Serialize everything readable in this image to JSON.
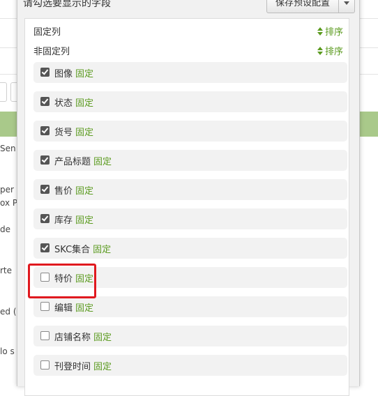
{
  "background": {
    "fragments": [
      "Sen",
      "per",
      "ox P",
      "de",
      "rte",
      "ed (",
      "lo s"
    ]
  },
  "modal": {
    "title": "请勾选要显示的字段",
    "preset_button": "保存预设配置"
  },
  "groups": {
    "fixed": {
      "label": "固定列",
      "sort": "排序"
    },
    "unfixed": {
      "label": "非固定列",
      "sort": "排序"
    }
  },
  "fields": [
    {
      "name": "图像",
      "pin": "固定",
      "checked": true
    },
    {
      "name": "状态",
      "pin": "固定",
      "checked": true
    },
    {
      "name": "货号",
      "pin": "固定",
      "checked": true
    },
    {
      "name": "产品标题",
      "pin": "固定",
      "checked": true
    },
    {
      "name": "售价",
      "pin": "固定",
      "checked": true
    },
    {
      "name": "库存",
      "pin": "固定",
      "checked": true
    },
    {
      "name": "SKC集合",
      "pin": "固定",
      "checked": true
    },
    {
      "name": "特价",
      "pin": "固定",
      "checked": false
    },
    {
      "name": "编辑",
      "pin": "固定",
      "checked": false
    },
    {
      "name": "店铺名称",
      "pin": "固定",
      "checked": false
    },
    {
      "name": "刊登时间",
      "pin": "固定",
      "checked": false
    }
  ],
  "colors": {
    "accent": "#5a9a1e",
    "highlight": "#e0191f"
  }
}
